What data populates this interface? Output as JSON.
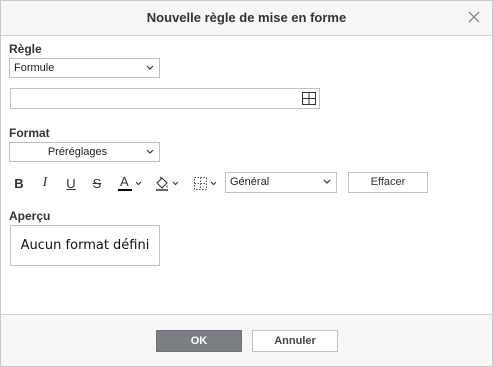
{
  "dialog": {
    "title": "Nouvelle règle de mise en forme",
    "close_icon": "close-icon"
  },
  "rule": {
    "label": "Règle",
    "type_selected": "Formule",
    "formula_value": "",
    "range_icon": "cell-range-icon"
  },
  "format": {
    "label": "Format",
    "presets_selected": "Préréglages",
    "toolbar": {
      "bold": "B",
      "italic": "I",
      "underline": "U",
      "strikethrough": "S",
      "font_color": "A",
      "font_color_swatch": "#000000",
      "fill_icon": "paint-bucket-icon",
      "borders_icon": "borders-icon"
    },
    "number_format_selected": "Général",
    "clear_label": "Effacer"
  },
  "preview": {
    "label": "Aperçu",
    "text": "Aucun format défini"
  },
  "footer": {
    "ok_label": "OK",
    "cancel_label": "Annuler"
  },
  "colors": {
    "ok_button": "#7b7f84",
    "titlebar": "#f7f7f7"
  }
}
